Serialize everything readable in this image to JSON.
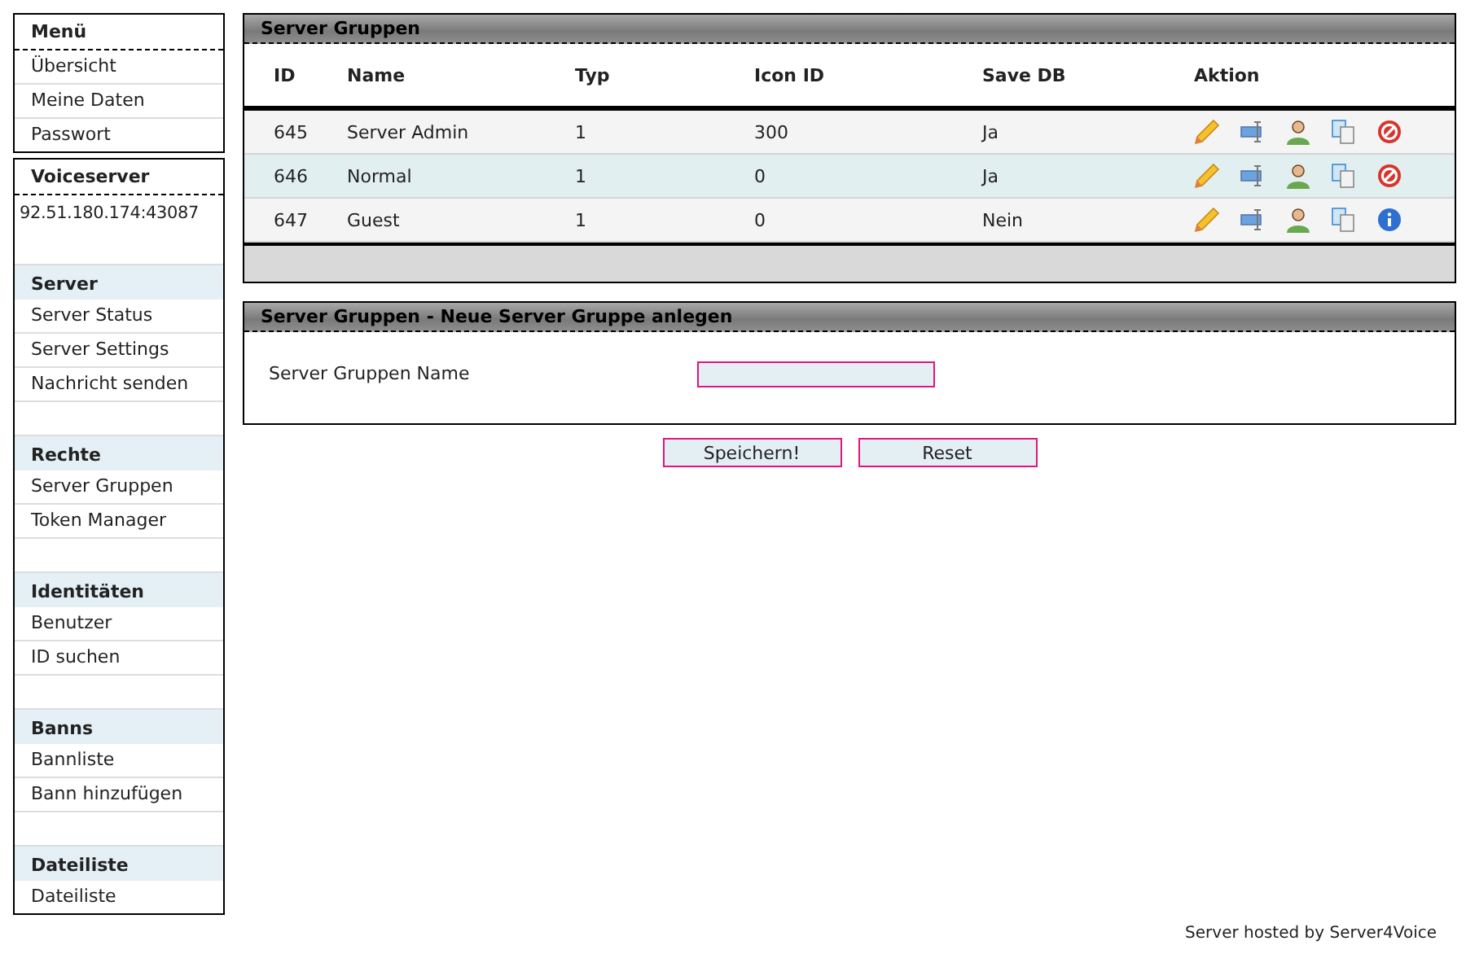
{
  "menu": {
    "title": "Menü",
    "items": [
      "Übersicht",
      "Meine Daten",
      "Passwort"
    ]
  },
  "voiceserver": {
    "title": "Voiceserver",
    "address": "92.51.180.174:43087",
    "sections": [
      {
        "title": "Server",
        "items": [
          "Server Status",
          "Server Settings",
          "Nachricht senden"
        ]
      },
      {
        "title": "Rechte",
        "items": [
          "Server Gruppen",
          "Token Manager"
        ]
      },
      {
        "title": "Identitäten",
        "items": [
          "Benutzer",
          "ID suchen"
        ]
      },
      {
        "title": "Banns",
        "items": [
          "Bannliste",
          "Bann hinzufügen"
        ]
      },
      {
        "title": "Dateiliste",
        "items": [
          "Dateiliste"
        ]
      }
    ]
  },
  "groups_panel": {
    "title": "Server Gruppen",
    "columns": [
      "ID",
      "Name",
      "Typ",
      "Icon ID",
      "Save DB",
      "Aktion"
    ],
    "rows": [
      {
        "cells": [
          "645",
          "Server Admin",
          "1",
          "300",
          "Ja"
        ],
        "actions": [
          {
            "kind": "edit"
          },
          {
            "kind": "move"
          },
          {
            "kind": "user"
          },
          {
            "kind": "copy"
          },
          {
            "kind": "delete"
          }
        ]
      },
      {
        "cells": [
          "646",
          "Normal",
          "1",
          "0",
          "Ja"
        ],
        "actions": [
          {
            "kind": "edit"
          },
          {
            "kind": "move"
          },
          {
            "kind": "user"
          },
          {
            "kind": "copy"
          },
          {
            "kind": "delete"
          }
        ]
      },
      {
        "cells": [
          "647",
          "Guest",
          "1",
          "0",
          "Nein"
        ],
        "actions": [
          {
            "kind": "edit"
          },
          {
            "kind": "move"
          },
          {
            "kind": "user"
          },
          {
            "kind": "copy"
          },
          {
            "kind": "info"
          }
        ]
      }
    ]
  },
  "new_group_panel": {
    "title": "Server Gruppen - Neue Server Gruppe anlegen",
    "field_label": "Server Gruppen Name"
  },
  "buttons": [
    "Speichern!",
    "Reset"
  ],
  "footer": "Server hosted by Server4Voice"
}
